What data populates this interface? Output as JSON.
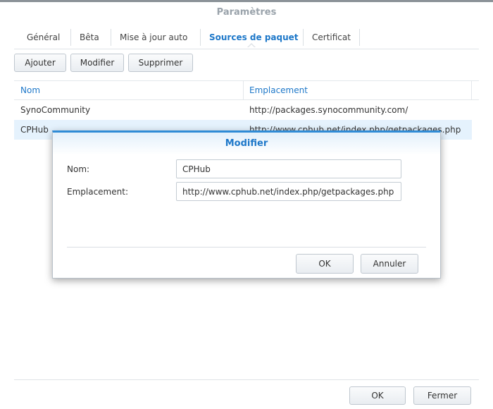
{
  "window": {
    "title": "Paramètres"
  },
  "tabs": [
    {
      "label": "Général"
    },
    {
      "label": "Bêta"
    },
    {
      "label": "Mise à jour auto"
    },
    {
      "label": "Sources de paquet",
      "active": true
    },
    {
      "label": "Certificat"
    }
  ],
  "toolbar": {
    "add_label": "Ajouter",
    "edit_label": "Modifier",
    "delete_label": "Supprimer"
  },
  "grid": {
    "columns": [
      "Nom",
      "Emplacement"
    ],
    "rows": [
      {
        "name": "SynoCommunity",
        "location": "http://packages.synocommunity.com/"
      },
      {
        "name": "CPHub",
        "location": "http://www.cphub.net/index.php/getpackages.php",
        "selected": true
      }
    ]
  },
  "footer": {
    "ok_label": "OK",
    "close_label": "Fermer"
  },
  "dialog": {
    "title": "Modifier",
    "name_label": "Nom:",
    "name_value": "CPHub",
    "location_label": "Emplacement:",
    "location_value": "http://www.cphub.net/index.php/getpackages.php",
    "ok_label": "OK",
    "cancel_label": "Annuler"
  },
  "colors": {
    "accent": "#1e78c9",
    "selected_row": "#e5f2fd"
  }
}
